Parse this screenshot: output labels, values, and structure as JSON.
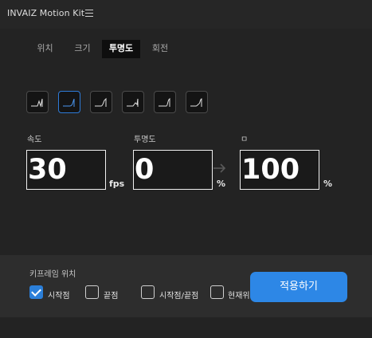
{
  "app": {
    "title": "INVAIZ Motion Kit",
    "menu_icon": "hamburger-menu-icon"
  },
  "tabs": [
    {
      "label": "위치",
      "active": false
    },
    {
      "label": "크기",
      "active": false
    },
    {
      "label": "투명도",
      "active": true
    },
    {
      "label": "회전",
      "active": false
    }
  ],
  "easing_presets": [
    {
      "icon": "ease-curve-icon",
      "selected": false
    },
    {
      "icon": "ease-curve-icon",
      "selected": true
    },
    {
      "icon": "ease-curve-icon",
      "selected": false
    },
    {
      "icon": "ease-curve-icon",
      "selected": false
    },
    {
      "icon": "ease-curve-icon",
      "selected": false
    },
    {
      "icon": "ease-curve-icon",
      "selected": false
    }
  ],
  "fields": {
    "speed": {
      "label": "속도",
      "value": "30",
      "unit": "fps"
    },
    "opacity_start": {
      "label": "투명도",
      "value": "0",
      "unit": "%"
    },
    "opacity_end": {
      "label": "ㅁ",
      "value": "100",
      "unit": "%"
    }
  },
  "keyframe": {
    "label": "키프레임 위치",
    "options": [
      {
        "label": "시작점",
        "checked": true
      },
      {
        "label": "끝점",
        "checked": false
      },
      {
        "label": "시작점/끝점",
        "checked": false
      },
      {
        "label": "현재위",
        "checked": false
      }
    ]
  },
  "apply_button": {
    "label": "적용하기"
  },
  "colors": {
    "accent": "#2d87e6",
    "background": "#232323",
    "panel": "#2d2d2d"
  }
}
